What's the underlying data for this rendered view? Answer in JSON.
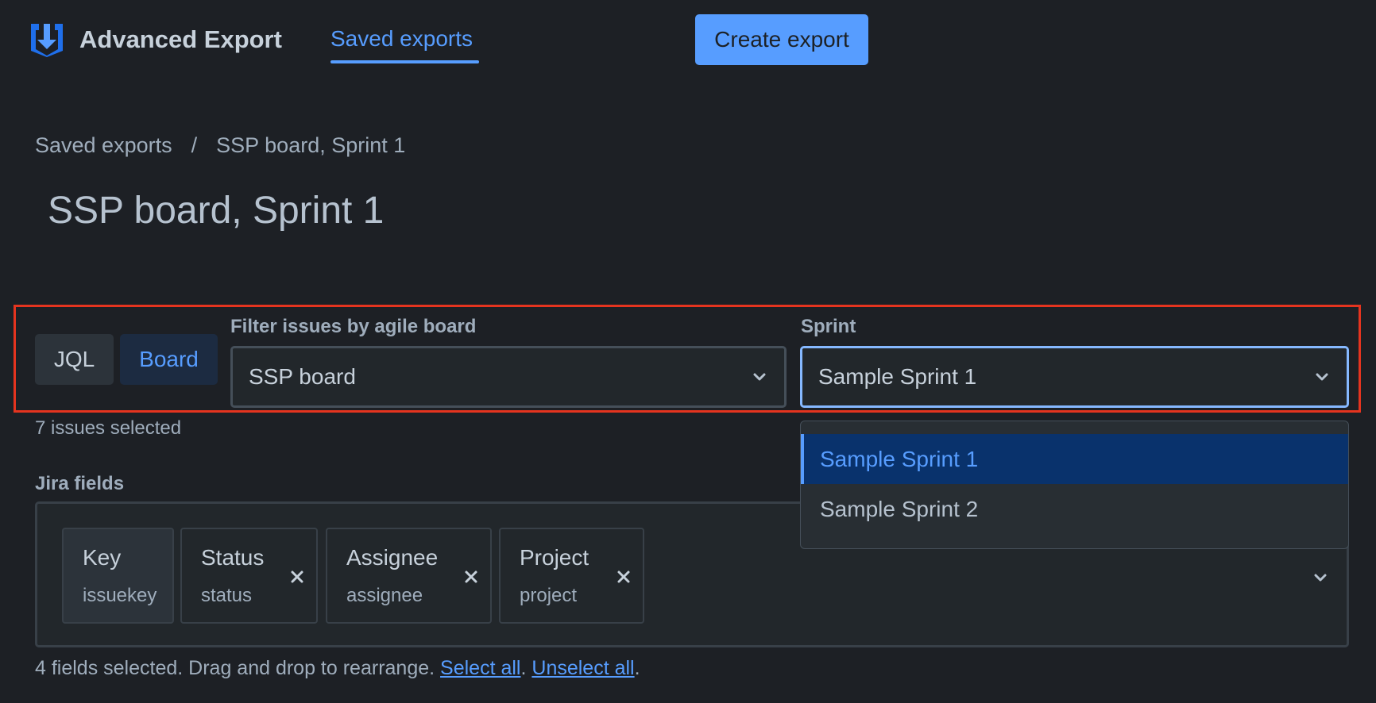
{
  "header": {
    "app_title": "Advanced Export",
    "nav_tab": "Saved exports",
    "create_button": "Create export",
    "logo_icon": "download-arrow-icon"
  },
  "breadcrumb": {
    "items": [
      "Saved exports",
      "SSP board, Sprint 1"
    ],
    "separator": "/"
  },
  "page_title": "SSP board, Sprint 1",
  "filter": {
    "toggle": {
      "jql": "JQL",
      "board": "Board",
      "active": "Board"
    },
    "board_label": "Filter issues by agile board",
    "board_value": "SSP board",
    "sprint_label": "Sprint",
    "sprint_value": "Sample Sprint 1",
    "sprint_options": [
      "Sample Sprint 1",
      "Sample Sprint 2"
    ],
    "issues_count": "7 issues selected"
  },
  "jira_fields": {
    "label": "Jira fields",
    "chips": [
      {
        "name": "Key",
        "key": "issuekey",
        "removable": false
      },
      {
        "name": "Status",
        "key": "status",
        "removable": true
      },
      {
        "name": "Assignee",
        "key": "assignee",
        "removable": true
      },
      {
        "name": "Project",
        "key": "project",
        "removable": true
      }
    ],
    "note": "4 fields selected. Drag and drop to rearrange.",
    "select_all": "Select all",
    "unselect_all": "Unselect all"
  },
  "colors": {
    "background": "#1d2025",
    "accent": "#579dff",
    "highlight_border": "#e5341f",
    "selected_option_bg": "#09326c"
  }
}
